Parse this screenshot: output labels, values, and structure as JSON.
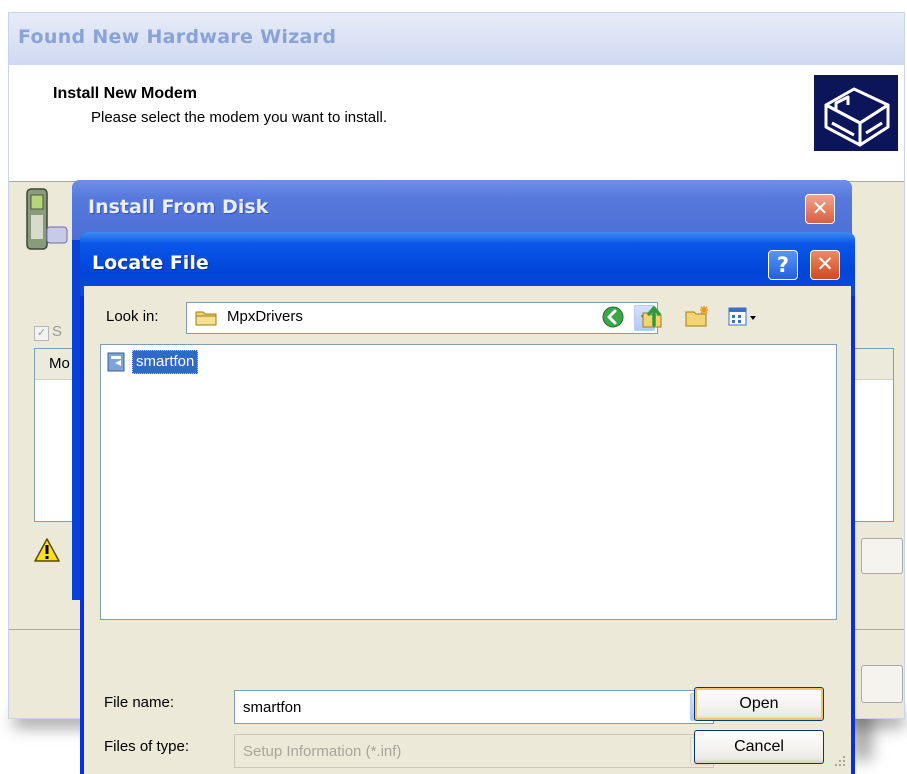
{
  "wizard": {
    "title": "Found New Hardware Wizard",
    "heading": "Install New Modem",
    "subheading": "Please select the modem you want to install.",
    "checkbox_label_partial": "S",
    "list_column_partial": "Mo"
  },
  "install_from_disk": {
    "title": "Install From Disk",
    "close_symbol": "✕"
  },
  "locate_file": {
    "title": "Locate File",
    "help_symbol": "?",
    "close_symbol": "✕",
    "look_in_label": "Look in:",
    "look_in_value": "MpxDrivers",
    "files": [
      {
        "name": "smartfon",
        "icon": "setup-information-file-icon",
        "selected": true
      }
    ],
    "file_name_label": "File name:",
    "file_name_value": "smartfon",
    "files_of_type_label": "Files of type:",
    "files_of_type_value": "Setup Information (*.inf)",
    "open_label": "Open",
    "cancel_label": "Cancel"
  },
  "colors": {
    "xp_title_blue": "#0a58e8",
    "selection_blue": "#316ac5",
    "dialog_face": "#ece9d8",
    "close_red": "#d2481c"
  }
}
